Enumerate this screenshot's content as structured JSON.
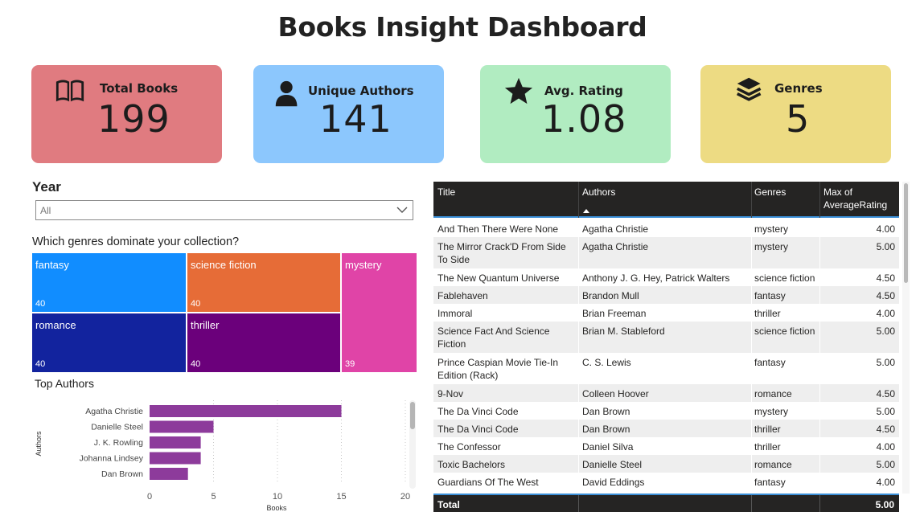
{
  "dashboard": {
    "title": "Books Insight Dashboard"
  },
  "kpis": [
    {
      "label": "Total Books",
      "value": "199",
      "color": "#e07b80",
      "icon": "book-open-icon"
    },
    {
      "label": "Unique Authors",
      "value": "141",
      "color": "#8cc7fd",
      "icon": "user-icon"
    },
    {
      "label": "Avg. Rating",
      "value": "1.08",
      "color": "#b1ecc1",
      "icon": "star-icon"
    },
    {
      "label": "Genres",
      "value": "5",
      "color": "#eddb83",
      "icon": "layers-icon"
    }
  ],
  "year_slicer": {
    "label": "Year",
    "value": "All"
  },
  "treemap": {
    "title": "Which genres dominate your collection?",
    "tiles": [
      {
        "name": "fantasy",
        "count": "40",
        "color": "#118dff"
      },
      {
        "name": "science fiction",
        "count": "40",
        "color": "#e66c37"
      },
      {
        "name": "mystery",
        "count": "39",
        "color": "#e044a7"
      },
      {
        "name": "romance",
        "count": "40",
        "color": "#12239e"
      },
      {
        "name": "thriller",
        "count": "40",
        "color": "#6b007b"
      }
    ]
  },
  "top_authors": {
    "title": "Top Authors",
    "chart_data": {
      "type": "bar",
      "orientation": "horizontal",
      "categories": [
        "Agatha Christie",
        "Danielle Steel",
        "J. K. Rowling",
        "Johanna Lindsey",
        "Dan Brown"
      ],
      "values": [
        15,
        5,
        4,
        4,
        3
      ],
      "xlabel": "Books",
      "ylabel": "Authors",
      "xticks": [
        "0",
        "5",
        "10",
        "15",
        "20"
      ],
      "xlim": [
        0,
        20
      ],
      "bar_color": "#8d3b9b"
    }
  },
  "table": {
    "columns": [
      "Title",
      "Authors",
      "Genres",
      "Max of AverageRating"
    ],
    "rows": [
      [
        "And Then There Were None",
        "Agatha Christie",
        "mystery",
        "4.00"
      ],
      [
        "The Mirror Crack'D From Side To Side",
        "Agatha Christie",
        "mystery",
        "5.00"
      ],
      [
        "The New Quantum Universe",
        "Anthony J. G. Hey, Patrick Walters",
        "science fiction",
        "4.50"
      ],
      [
        "Fablehaven",
        "Brandon Mull",
        "fantasy",
        "4.50"
      ],
      [
        "Immoral",
        "Brian Freeman",
        "thriller",
        "4.00"
      ],
      [
        "Science Fact And Science Fiction",
        "Brian M. Stableford",
        "science fiction",
        "5.00"
      ],
      [
        "Prince Caspian Movie Tie-In Edition (Rack)",
        "C. S. Lewis",
        "fantasy",
        "5.00"
      ],
      [
        "9-Nov",
        "Colleen Hoover",
        "romance",
        "4.50"
      ],
      [
        "The Da Vinci Code",
        "Dan Brown",
        "mystery",
        "5.00"
      ],
      [
        "The Da Vinci Code",
        "Dan Brown",
        "thriller",
        "4.50"
      ],
      [
        "The Confessor",
        "Daniel Silva",
        "thriller",
        "4.00"
      ],
      [
        "Toxic Bachelors",
        "Danielle Steel",
        "romance",
        "5.00"
      ],
      [
        "Guardians Of The West",
        "David Eddings",
        "fantasy",
        "4.00"
      ]
    ],
    "total_label": "Total",
    "total_value": "5.00"
  }
}
